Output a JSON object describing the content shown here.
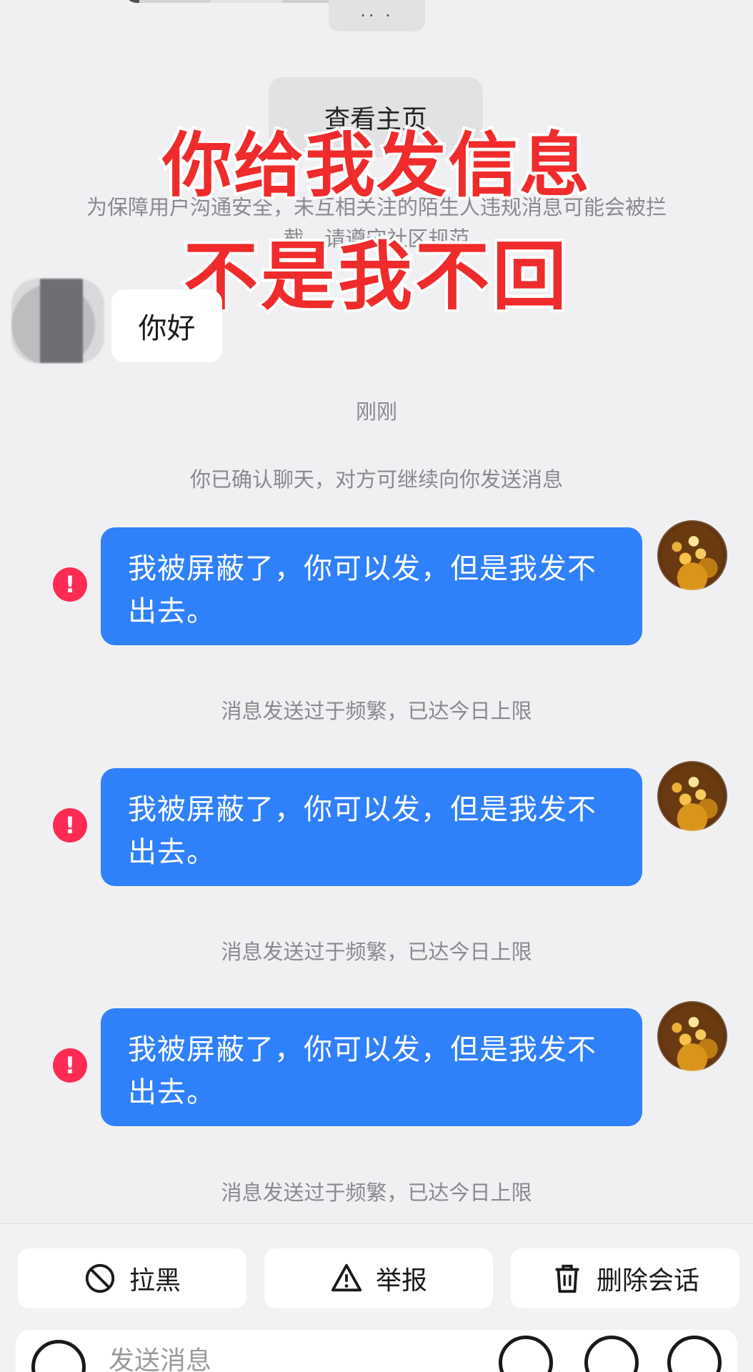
{
  "header": {
    "view_profile_label": "查看主页",
    "safety_notice": "为保障用户沟通安全，未互相关注的陌生人违规消息可能会被拦截，请遵守社区规范"
  },
  "overlay": {
    "line1": "你给我发信息",
    "line2": "不是我不回"
  },
  "chat": {
    "incoming": {
      "text": "你好"
    },
    "time_label": "刚刚",
    "confirm_note": "你已确认聊天，对方可继续向你发送消息",
    "outgoing": [
      {
        "text": "我被屏蔽了，你可以发，但是我发不出去。",
        "error_icon": "!",
        "status": "消息发送过于频繁，已达今日上限"
      },
      {
        "text": "我被屏蔽了，你可以发，但是我发不出去。",
        "error_icon": "!",
        "status": "消息发送过于频繁，已达今日上限"
      },
      {
        "text": "我被屏蔽了，你可以发，但是我发不出去。",
        "error_icon": "!",
        "status": "消息发送过于频繁，已达今日上限"
      }
    ]
  },
  "actions": {
    "block_label": "拉黑",
    "report_label": "举报",
    "delete_label": "删除会话"
  },
  "composer": {
    "placeholder": "发送消息"
  },
  "colors": {
    "bubble_blue": "#2f80fb",
    "error_red": "#fe2c55",
    "overlay_red": "#ef2b2b",
    "background": "#f0f0f2"
  },
  "icons": {
    "block": "ban-icon",
    "report": "warning-icon",
    "delete": "trash-icon",
    "camera": "camera-icon",
    "voice": "voice-icon",
    "emoji": "emoji-icon",
    "plus": "plus-icon"
  }
}
